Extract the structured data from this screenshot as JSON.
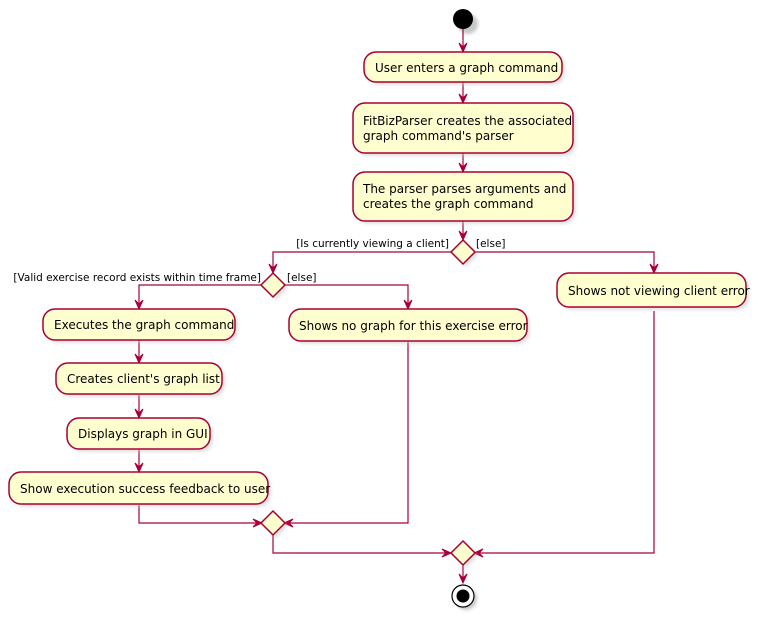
{
  "diagram": {
    "type": "activity",
    "colors": {
      "line": "#A80036",
      "activity_fill": "#FEFECE",
      "start_fill": "#000000"
    },
    "activities": {
      "enter_command": [
        "User enters a graph command"
      ],
      "create_parser": [
        "FitBizParser creates the associated",
        "graph command's parser"
      ],
      "parse_args": [
        "The parser parses arguments and",
        "creates the graph command"
      ],
      "execute": [
        "Executes the graph command"
      ],
      "create_list": [
        "Creates client's graph list"
      ],
      "display": [
        "Displays graph in GUI"
      ],
      "success": [
        "Show execution success feedback to user"
      ],
      "no_graph_error": [
        "Shows no graph for this exercise error"
      ],
      "not_viewing_error": [
        "Shows not viewing client error"
      ]
    },
    "guards": {
      "viewing_client": "[Is currently viewing a client]",
      "viewing_else": "[else]",
      "record_exists": "[Valid exercise record exists within time frame]",
      "record_else": "[else]"
    }
  }
}
